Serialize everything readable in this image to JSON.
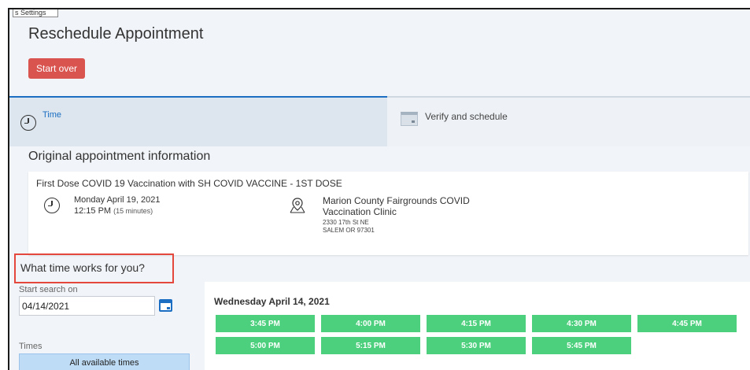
{
  "window": {
    "tab_label": "s Settings"
  },
  "header": {
    "title": "Reschedule Appointment",
    "start_over_label": "Start over"
  },
  "steps": [
    {
      "label": "Time",
      "icon": "clock-icon",
      "active": true,
      "accent": "#1b6ec2"
    },
    {
      "label": "Verify and schedule",
      "icon": "calendar-icon",
      "active": false
    }
  ],
  "original": {
    "heading": "Original appointment information",
    "title": "First Dose COVID 19 Vaccination with SH COVID VACCINE - 1ST DOSE",
    "date": "Monday April 19, 2021",
    "time": "12:15 PM",
    "duration": "(15 minutes)",
    "location_name": "Marion County Fairgrounds COVID Vaccination Clinic",
    "address_line1": "2330 17th St NE",
    "address_line2": "SALEM OR 97301"
  },
  "search": {
    "heading": "What time works for you?",
    "start_label": "Start search on",
    "start_value": "04/14/2021",
    "times_label": "Times",
    "times_selected": "All available times"
  },
  "slots": {
    "date_heading": "Wednesday April 14, 2021",
    "times": [
      "3:45 PM",
      "4:00 PM",
      "4:15 PM",
      "4:30 PM",
      "4:45 PM",
      "5:00 PM",
      "5:15 PM",
      "5:30 PM",
      "5:45 PM"
    ],
    "color": "#4cd07d"
  },
  "colors": {
    "danger": "#d9534f",
    "highlight_box": "#e4473c",
    "selected": "#bfdcf6"
  }
}
